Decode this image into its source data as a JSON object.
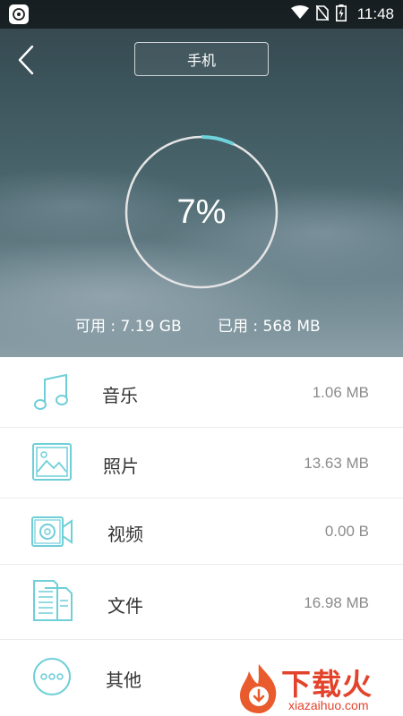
{
  "status_bar": {
    "time": "11:48"
  },
  "header": {
    "storage_tab_label": "手机"
  },
  "gauge": {
    "percent_text": "7%",
    "used_fraction": 0.07
  },
  "capacity": {
    "available_label": "可用 : 7.19 GB",
    "used_label": "已用 : 568 MB"
  },
  "categories": [
    {
      "label": "音乐",
      "size": "1.06 MB",
      "icon": "music-note-icon"
    },
    {
      "label": "照片",
      "size": "13.63 MB",
      "icon": "photo-icon"
    },
    {
      "label": "视频",
      "size": "0.00 B",
      "icon": "video-camera-icon"
    },
    {
      "label": "文件",
      "size": "16.98 MB",
      "icon": "document-icon"
    },
    {
      "label": "其他",
      "size": "",
      "icon": "more-dots-icon"
    }
  ],
  "watermark": {
    "title": "下载火",
    "subtitle": "xiazaihuo.com"
  },
  "colors": {
    "accent": "#6fd3dc",
    "icon_stroke": "#6fcfd8",
    "watermark": "#e2432a"
  }
}
